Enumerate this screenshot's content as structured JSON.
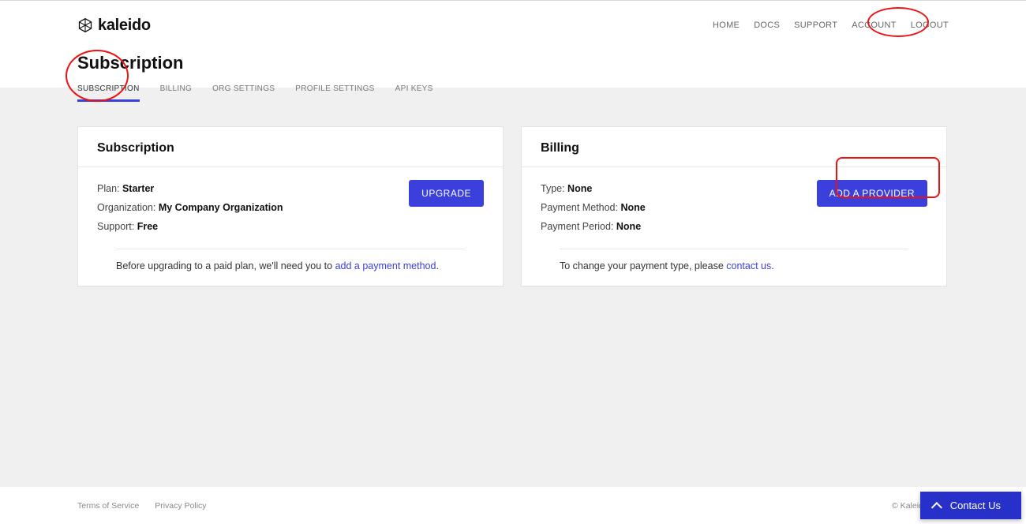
{
  "brand": {
    "name": "kaleido"
  },
  "nav": {
    "home": "HOME",
    "docs": "DOCS",
    "support": "SUPPORT",
    "account": "ACCOUNT",
    "logout": "LOGOUT"
  },
  "page": {
    "title": "Subscription"
  },
  "tabs": {
    "subscription": "SUBSCRIPTION",
    "billing": "BILLING",
    "org_settings": "ORG SETTINGS",
    "profile_settings": "PROFILE SETTINGS",
    "api_keys": "API KEYS"
  },
  "subscription_card": {
    "title": "Subscription",
    "plan_label": "Plan: ",
    "plan_value": "Starter",
    "org_label": "Organization: ",
    "org_value": "My Company Organization",
    "support_label": "Support: ",
    "support_value": "Free",
    "upgrade_btn": "UPGRADE",
    "footer_pre": "Before upgrading to a paid plan, we'll need you to ",
    "footer_link": "add a payment method",
    "footer_post": "."
  },
  "billing_card": {
    "title": "Billing",
    "type_label": "Type: ",
    "type_value": "None",
    "method_label": "Payment Method: ",
    "method_value": "None",
    "period_label": "Payment Period: ",
    "period_value": "None",
    "add_btn": "ADD A PROVIDER",
    "footer_pre": "To change your payment type, please ",
    "footer_link": "contact us",
    "footer_post": "."
  },
  "footer": {
    "tos": "Terms of Service",
    "privacy": "Privacy Policy",
    "copyright": "© Kaleido 2020"
  },
  "widget": {
    "label": "Contact Us"
  }
}
